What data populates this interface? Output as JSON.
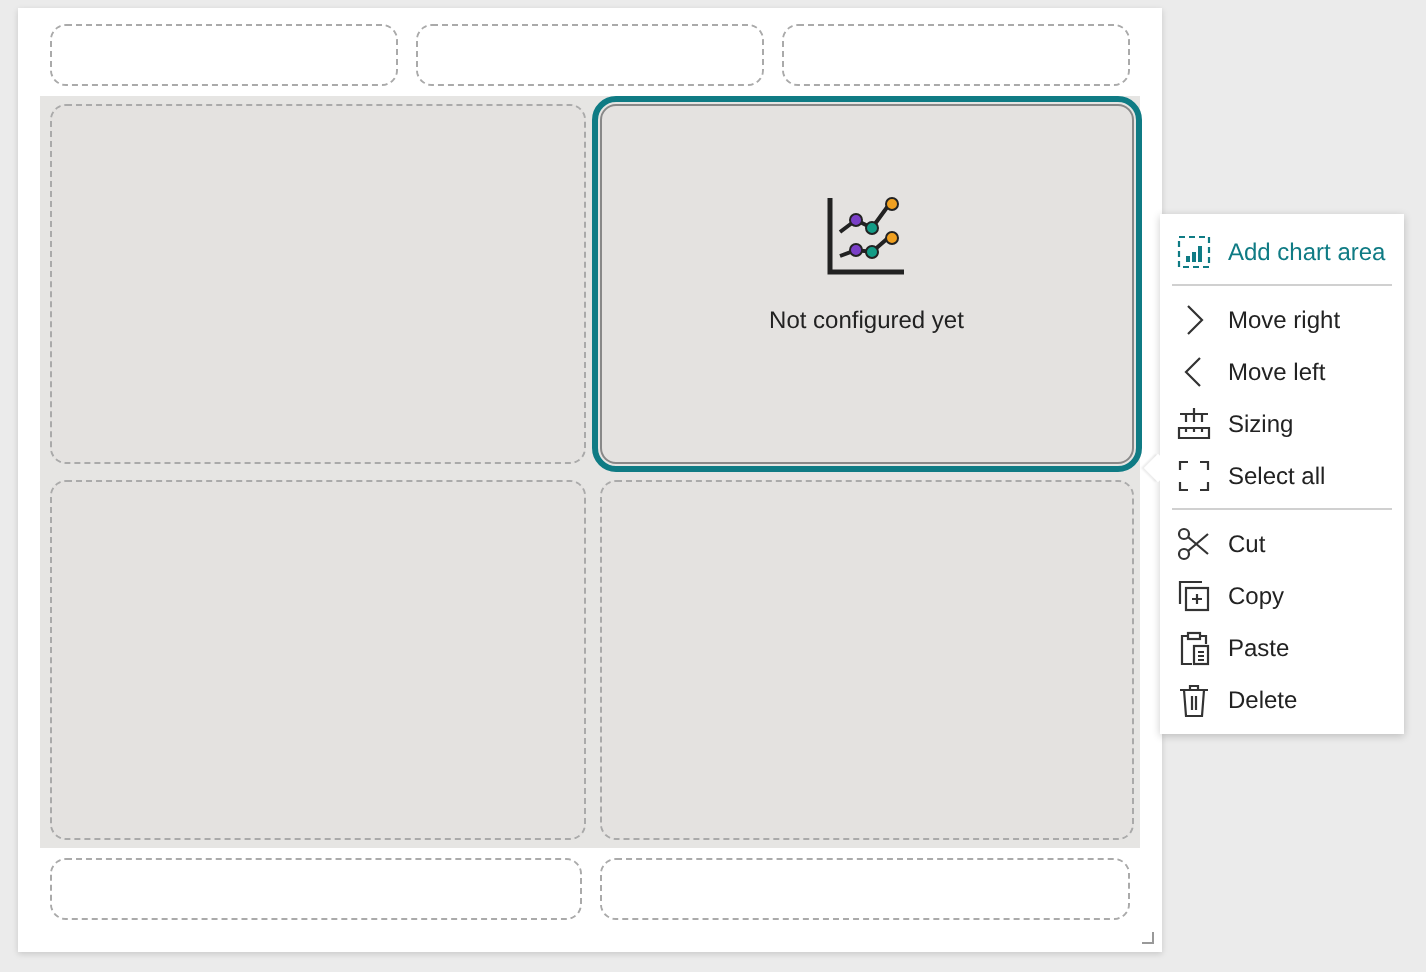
{
  "header_slots": [
    {
      "selected": false
    },
    {
      "selected": false
    },
    {
      "selected": false
    }
  ],
  "panels": [
    {
      "kind": "empty",
      "selected": false
    },
    {
      "kind": "chart",
      "selected": true,
      "status": "Not configured yet"
    },
    {
      "kind": "empty",
      "selected": false
    },
    {
      "kind": "empty",
      "selected": false
    }
  ],
  "footer_slots": [
    {
      "selected": false
    },
    {
      "selected": false
    }
  ],
  "context_menu": {
    "groups": [
      [
        {
          "label": "Add chart area",
          "selected": true
        }
      ],
      [
        {
          "label": "Move right",
          "selected": false
        },
        {
          "label": "Move left",
          "selected": false
        },
        {
          "label": "Sizing",
          "selected": false
        },
        {
          "label": "Select all",
          "selected": false
        }
      ],
      [
        {
          "label": "Cut",
          "selected": false
        },
        {
          "label": "Copy",
          "selected": false
        },
        {
          "label": "Paste",
          "selected": false
        },
        {
          "label": "Delete",
          "selected": false
        }
      ]
    ]
  }
}
